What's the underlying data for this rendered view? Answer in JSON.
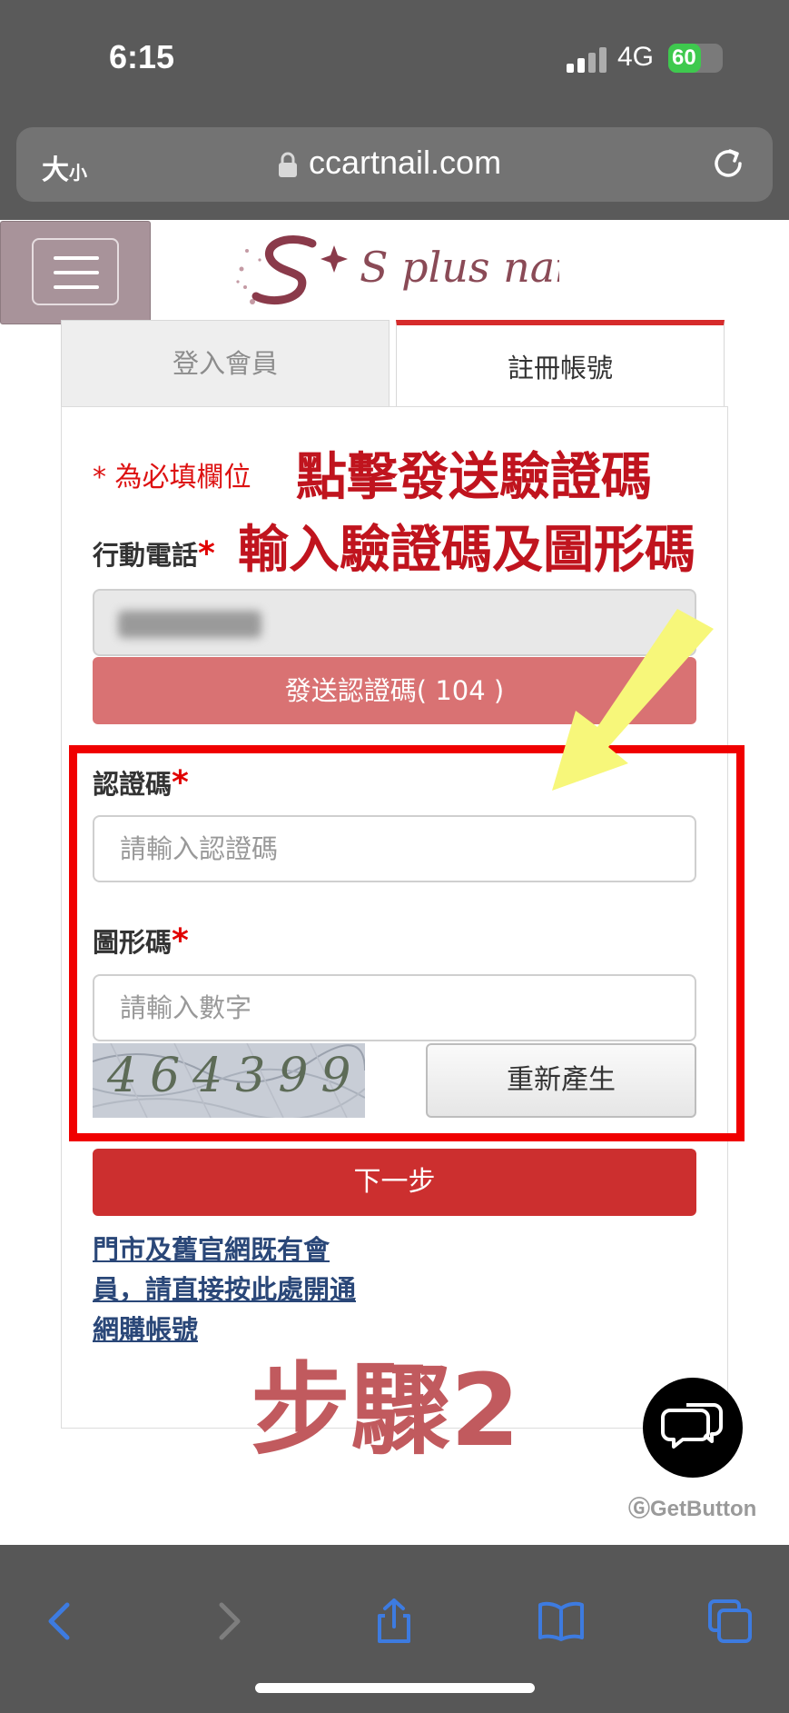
{
  "status_bar": {
    "time": "6:15",
    "network": "4G",
    "battery_percent": 60,
    "battery_label": "60"
  },
  "url_bar": {
    "text_size_label": "大",
    "text_size_small": "小",
    "url": "ccartnail.com"
  },
  "header": {
    "menu_icon": "hamburger-icon",
    "logo_text": "S plus nail"
  },
  "tabs": [
    {
      "label": "登入會員",
      "active": false
    },
    {
      "label": "註冊帳號",
      "active": true
    }
  ],
  "form": {
    "required_note": "* 為必填欄位",
    "phone_label": "行動電話",
    "send_code_label": "發送認證碼( 104 )",
    "code_label": "認證碼",
    "code_placeholder": "請輸入認證碼",
    "captcha_label": "圖形碼",
    "captcha_placeholder": "請輸入數字",
    "captcha_text": "464399",
    "regenerate_label": "重新產生",
    "next_label": "下一步",
    "member_link": "門市及舊官網既有會員，請直接按此處開通網購帳號",
    "required_star": "*"
  },
  "annotations": {
    "line1": "點擊發送驗證碼",
    "line2": "輸入驗證碼及圖形碼",
    "step": "步驟2",
    "arrow_color": "#f7f77a",
    "box_color": "#f00000"
  },
  "chat": {
    "icon": "chat-bubbles-icon",
    "brand": "GetButton"
  },
  "toolbar": {
    "icons": [
      "back-icon",
      "forward-icon",
      "share-icon",
      "bookmarks-icon",
      "tabs-icon"
    ]
  },
  "colors": {
    "accent_red": "#cc2f2f",
    "send_button": "#d97273",
    "link": "#2a4778",
    "ios_blue": "#3d7be0"
  }
}
